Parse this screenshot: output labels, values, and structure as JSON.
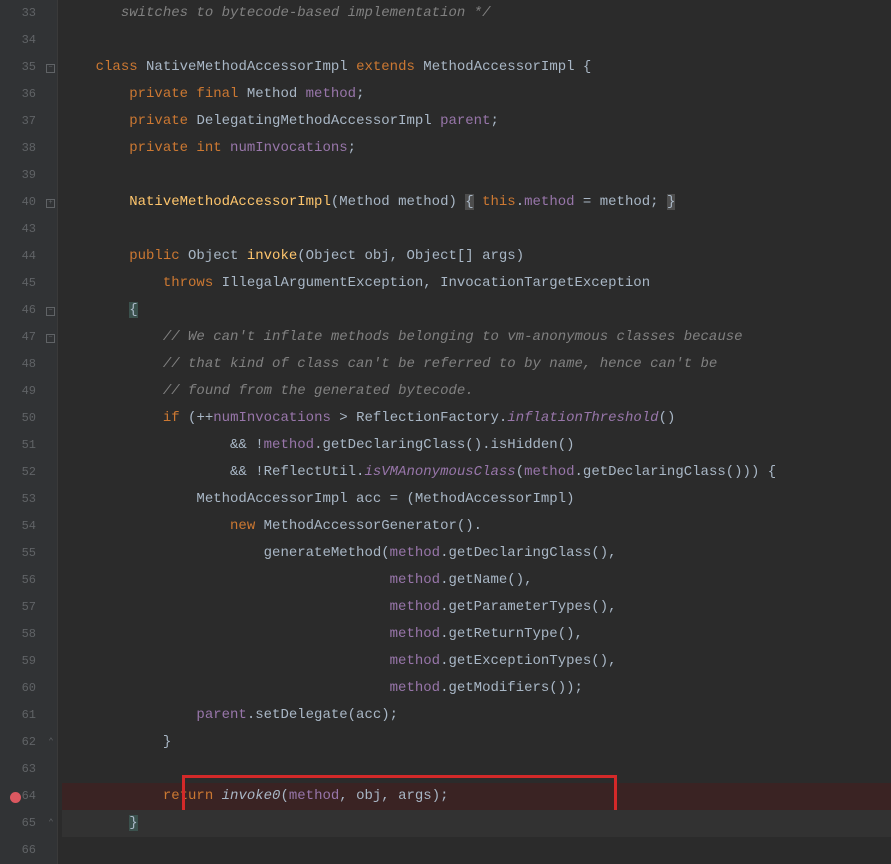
{
  "lines": [
    {
      "n": 33,
      "fold": "",
      "tokens": [
        {
          "cls": "",
          "t": "       "
        },
        {
          "cls": "c-comment",
          "t": "switches to bytecode-based implementation */"
        }
      ]
    },
    {
      "n": 34,
      "fold": "",
      "tokens": [
        {
          "cls": "",
          "t": ""
        }
      ]
    },
    {
      "n": 35,
      "fold": "-",
      "tokens": [
        {
          "cls": "",
          "t": "    "
        },
        {
          "cls": "c-keyword",
          "t": "class "
        },
        {
          "cls": "c-default",
          "t": "NativeMethodAccessorImpl "
        },
        {
          "cls": "c-keyword",
          "t": "extends "
        },
        {
          "cls": "c-default",
          "t": "MethodAccessorImpl {"
        }
      ]
    },
    {
      "n": 36,
      "fold": "",
      "tokens": [
        {
          "cls": "",
          "t": "        "
        },
        {
          "cls": "c-keyword",
          "t": "private final "
        },
        {
          "cls": "c-default",
          "t": "Method "
        },
        {
          "cls": "c-field",
          "t": "method"
        },
        {
          "cls": "c-default",
          "t": ";"
        }
      ]
    },
    {
      "n": 37,
      "fold": "",
      "tokens": [
        {
          "cls": "",
          "t": "        "
        },
        {
          "cls": "c-keyword",
          "t": "private "
        },
        {
          "cls": "c-default",
          "t": "DelegatingMethodAccessorImpl "
        },
        {
          "cls": "c-field",
          "t": "parent"
        },
        {
          "cls": "c-default",
          "t": ";"
        }
      ]
    },
    {
      "n": 38,
      "fold": "",
      "tokens": [
        {
          "cls": "",
          "t": "        "
        },
        {
          "cls": "c-keyword",
          "t": "private int "
        },
        {
          "cls": "c-field",
          "t": "numInvocations"
        },
        {
          "cls": "c-default",
          "t": ";"
        }
      ]
    },
    {
      "n": 39,
      "fold": "",
      "tokens": [
        {
          "cls": "",
          "t": ""
        }
      ]
    },
    {
      "n": 40,
      "fold": "+",
      "tokens": [
        {
          "cls": "",
          "t": "        "
        },
        {
          "cls": "c-method",
          "t": "NativeMethodAccessorImpl"
        },
        {
          "cls": "c-default",
          "t": "(Method method) "
        },
        {
          "cls": "c-brace-hl",
          "t": "{"
        },
        {
          "cls": "c-default",
          "t": " "
        },
        {
          "cls": "c-keyword",
          "t": "this"
        },
        {
          "cls": "c-default",
          "t": "."
        },
        {
          "cls": "c-field",
          "t": "method"
        },
        {
          "cls": "c-default",
          "t": " = method; "
        },
        {
          "cls": "c-brace-hl",
          "t": "}"
        }
      ]
    },
    {
      "n": 43,
      "fold": "",
      "tokens": [
        {
          "cls": "",
          "t": ""
        }
      ]
    },
    {
      "n": 44,
      "fold": "",
      "mod": true,
      "tokens": [
        {
          "cls": "",
          "t": "        "
        },
        {
          "cls": "c-keyword",
          "t": "public "
        },
        {
          "cls": "c-default",
          "t": "Object "
        },
        {
          "cls": "c-method",
          "t": "invoke"
        },
        {
          "cls": "c-default",
          "t": "(Object obj, Object[] args)"
        }
      ]
    },
    {
      "n": 45,
      "fold": "",
      "tokens": [
        {
          "cls": "",
          "t": "            "
        },
        {
          "cls": "c-keyword",
          "t": "throws "
        },
        {
          "cls": "c-default",
          "t": "IllegalArgumentException, InvocationTargetException"
        }
      ]
    },
    {
      "n": 46,
      "fold": "-",
      "tokens": [
        {
          "cls": "",
          "t": "        "
        },
        {
          "cls": "c-bracebg",
          "t": "{"
        }
      ]
    },
    {
      "n": 47,
      "fold": "-",
      "tokens": [
        {
          "cls": "",
          "t": "            "
        },
        {
          "cls": "c-comment",
          "t": "// We can't inflate methods belonging to vm-anonymous classes because"
        }
      ]
    },
    {
      "n": 48,
      "fold": "",
      "tokens": [
        {
          "cls": "",
          "t": "            "
        },
        {
          "cls": "c-comment",
          "t": "// that kind of class can't be referred to by name, hence can't be"
        }
      ]
    },
    {
      "n": 49,
      "fold": "",
      "tokens": [
        {
          "cls": "",
          "t": "            "
        },
        {
          "cls": "c-comment",
          "t": "// found from the generated bytecode."
        }
      ]
    },
    {
      "n": 50,
      "fold": "",
      "tokens": [
        {
          "cls": "",
          "t": "            "
        },
        {
          "cls": "c-keyword",
          "t": "if "
        },
        {
          "cls": "c-default",
          "t": "(++"
        },
        {
          "cls": "c-field",
          "t": "numInvocations"
        },
        {
          "cls": "c-default",
          "t": " > ReflectionFactory."
        },
        {
          "cls": "c-static",
          "t": "inflationThreshold"
        },
        {
          "cls": "c-default",
          "t": "()"
        }
      ]
    },
    {
      "n": 51,
      "fold": "",
      "tokens": [
        {
          "cls": "",
          "t": "                    "
        },
        {
          "cls": "c-default",
          "t": "&& !"
        },
        {
          "cls": "c-field",
          "t": "method"
        },
        {
          "cls": "c-default",
          "t": ".getDeclaringClass().isHidden()"
        }
      ]
    },
    {
      "n": 52,
      "fold": "",
      "tokens": [
        {
          "cls": "",
          "t": "                    "
        },
        {
          "cls": "c-default",
          "t": "&& !ReflectUtil."
        },
        {
          "cls": "c-static",
          "t": "isVMAnonymousClass"
        },
        {
          "cls": "c-default",
          "t": "("
        },
        {
          "cls": "c-field",
          "t": "method"
        },
        {
          "cls": "c-default",
          "t": ".getDeclaringClass())) {"
        }
      ]
    },
    {
      "n": 53,
      "fold": "",
      "tokens": [
        {
          "cls": "",
          "t": "                "
        },
        {
          "cls": "c-default",
          "t": "MethodAccessorImpl acc = (MethodAccessorImpl)"
        }
      ]
    },
    {
      "n": 54,
      "fold": "",
      "tokens": [
        {
          "cls": "",
          "t": "                    "
        },
        {
          "cls": "c-keyword",
          "t": "new "
        },
        {
          "cls": "c-default",
          "t": "MethodAccessorGenerator()."
        }
      ]
    },
    {
      "n": 55,
      "fold": "",
      "tokens": [
        {
          "cls": "",
          "t": "                        "
        },
        {
          "cls": "c-default",
          "t": "generateMethod("
        },
        {
          "cls": "c-field",
          "t": "method"
        },
        {
          "cls": "c-default",
          "t": ".getDeclaringClass(),"
        }
      ]
    },
    {
      "n": 56,
      "fold": "",
      "tokens": [
        {
          "cls": "",
          "t": "                                       "
        },
        {
          "cls": "c-field",
          "t": "method"
        },
        {
          "cls": "c-default",
          "t": ".getName(),"
        }
      ]
    },
    {
      "n": 57,
      "fold": "",
      "tokens": [
        {
          "cls": "",
          "t": "                                       "
        },
        {
          "cls": "c-field",
          "t": "method"
        },
        {
          "cls": "c-default",
          "t": ".getParameterTypes(),"
        }
      ]
    },
    {
      "n": 58,
      "fold": "",
      "tokens": [
        {
          "cls": "",
          "t": "                                       "
        },
        {
          "cls": "c-field",
          "t": "method"
        },
        {
          "cls": "c-default",
          "t": ".getReturnType(),"
        }
      ]
    },
    {
      "n": 59,
      "fold": "",
      "tokens": [
        {
          "cls": "",
          "t": "                                       "
        },
        {
          "cls": "c-field",
          "t": "method"
        },
        {
          "cls": "c-default",
          "t": ".getExceptionTypes(),"
        }
      ]
    },
    {
      "n": 60,
      "fold": "",
      "tokens": [
        {
          "cls": "",
          "t": "                                       "
        },
        {
          "cls": "c-field",
          "t": "method"
        },
        {
          "cls": "c-default",
          "t": ".getModifiers());"
        }
      ]
    },
    {
      "n": 61,
      "fold": "",
      "tokens": [
        {
          "cls": "",
          "t": "                "
        },
        {
          "cls": "c-field",
          "t": "parent"
        },
        {
          "cls": "c-default",
          "t": ".setDelegate(acc);"
        }
      ]
    },
    {
      "n": 62,
      "fold": "^",
      "tokens": [
        {
          "cls": "",
          "t": "            "
        },
        {
          "cls": "c-default",
          "t": "}"
        }
      ]
    },
    {
      "n": 63,
      "fold": "",
      "tokens": [
        {
          "cls": "",
          "t": ""
        }
      ]
    },
    {
      "n": 64,
      "fold": "",
      "bp": true,
      "hl": true,
      "tokens": [
        {
          "cls": "",
          "t": "            "
        },
        {
          "cls": "c-keyword",
          "t": "return "
        },
        {
          "cls": "c-italic-call",
          "t": "invoke0"
        },
        {
          "cls": "c-default",
          "t": "("
        },
        {
          "cls": "c-field",
          "t": "method"
        },
        {
          "cls": "c-default",
          "t": ", obj, args);"
        }
      ]
    },
    {
      "n": 65,
      "fold": "^",
      "cursor": true,
      "tokens": [
        {
          "cls": "",
          "t": "        "
        },
        {
          "cls": "c-bracebg",
          "t": "}"
        }
      ]
    },
    {
      "n": 66,
      "fold": "",
      "tokens": [
        {
          "cls": "",
          "t": ""
        }
      ]
    }
  ]
}
